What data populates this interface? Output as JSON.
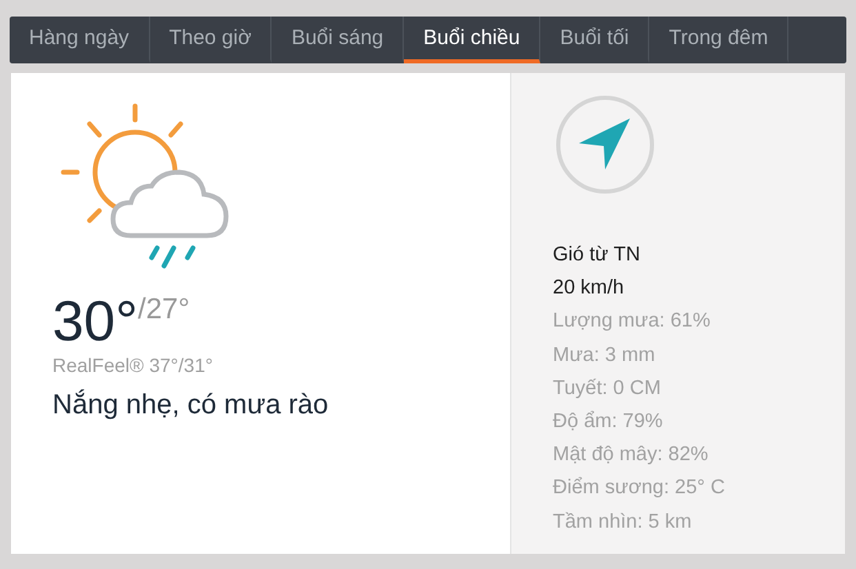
{
  "tabs": [
    {
      "label": "Hàng ngày",
      "selected": false
    },
    {
      "label": "Theo giờ",
      "selected": false
    },
    {
      "label": "Buổi sáng",
      "selected": false
    },
    {
      "label": "Buổi chiều",
      "selected": true
    },
    {
      "label": "Buổi tối",
      "selected": false
    },
    {
      "label": "Trong đêm",
      "selected": false
    }
  ],
  "forecast": {
    "high": "30°",
    "low": "/27°",
    "realfeel": "RealFeel® 37°/31°",
    "condition": "Nắng nhẹ, có mưa rào"
  },
  "details": [
    {
      "text": "Gió từ TN",
      "kind": "primary"
    },
    {
      "text": "20 km/h",
      "kind": "primary"
    },
    {
      "text": "Lượng mưa: 61%",
      "kind": "secondary"
    },
    {
      "text": "Mưa: 3 mm",
      "kind": "secondary"
    },
    {
      "text": "Tuyết: 0 CM",
      "kind": "secondary"
    },
    {
      "text": "Độ ẩm: 79%",
      "kind": "secondary"
    },
    {
      "text": "Mật độ mây: 82%",
      "kind": "secondary"
    },
    {
      "text": "Điểm sương: 25° C",
      "kind": "secondary"
    },
    {
      "text": "Tầm nhìn: 5 km",
      "kind": "secondary"
    }
  ]
}
